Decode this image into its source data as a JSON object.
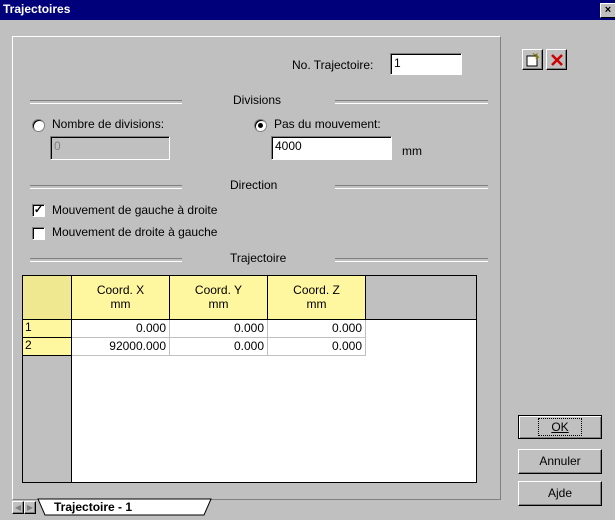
{
  "window": {
    "title": "Trajectoires",
    "close_label": "×"
  },
  "trajectory_no": {
    "label": "No. Trajectoire:",
    "value": "1"
  },
  "divisions": {
    "section_label": "Divisions",
    "count_option": "Nombre de divisions:",
    "count_value": "0",
    "step_option": "Pas du mouvement:",
    "step_value": "4000",
    "step_unit": "mm",
    "selected": "step"
  },
  "direction": {
    "section_label": "Direction",
    "left_to_right": {
      "label": "Mouvement de gauche à droite",
      "checked": true
    },
    "right_to_left": {
      "label": "Mouvement de droite à gauche",
      "checked": false
    }
  },
  "trajectory_table": {
    "section_label": "Trajectoire",
    "columns": [
      {
        "title": "Coord. X",
        "unit": "mm"
      },
      {
        "title": "Coord. Y",
        "unit": "mm"
      },
      {
        "title": "Coord. Z",
        "unit": "mm"
      }
    ],
    "rows": [
      {
        "index": "1",
        "values": [
          "0.000",
          "0.000",
          "0.000"
        ]
      },
      {
        "index": "2",
        "values": [
          "92000.000",
          "0.000",
          "0.000"
        ]
      }
    ]
  },
  "tabs": [
    {
      "label": "Trajectoire - 1"
    }
  ],
  "buttons": {
    "ok": "OK",
    "cancel": "Annuler",
    "help": "Ajde"
  },
  "icons": {
    "new": "new-document-icon",
    "delete": "delete-x-icon",
    "delete_color": "#d00000"
  }
}
